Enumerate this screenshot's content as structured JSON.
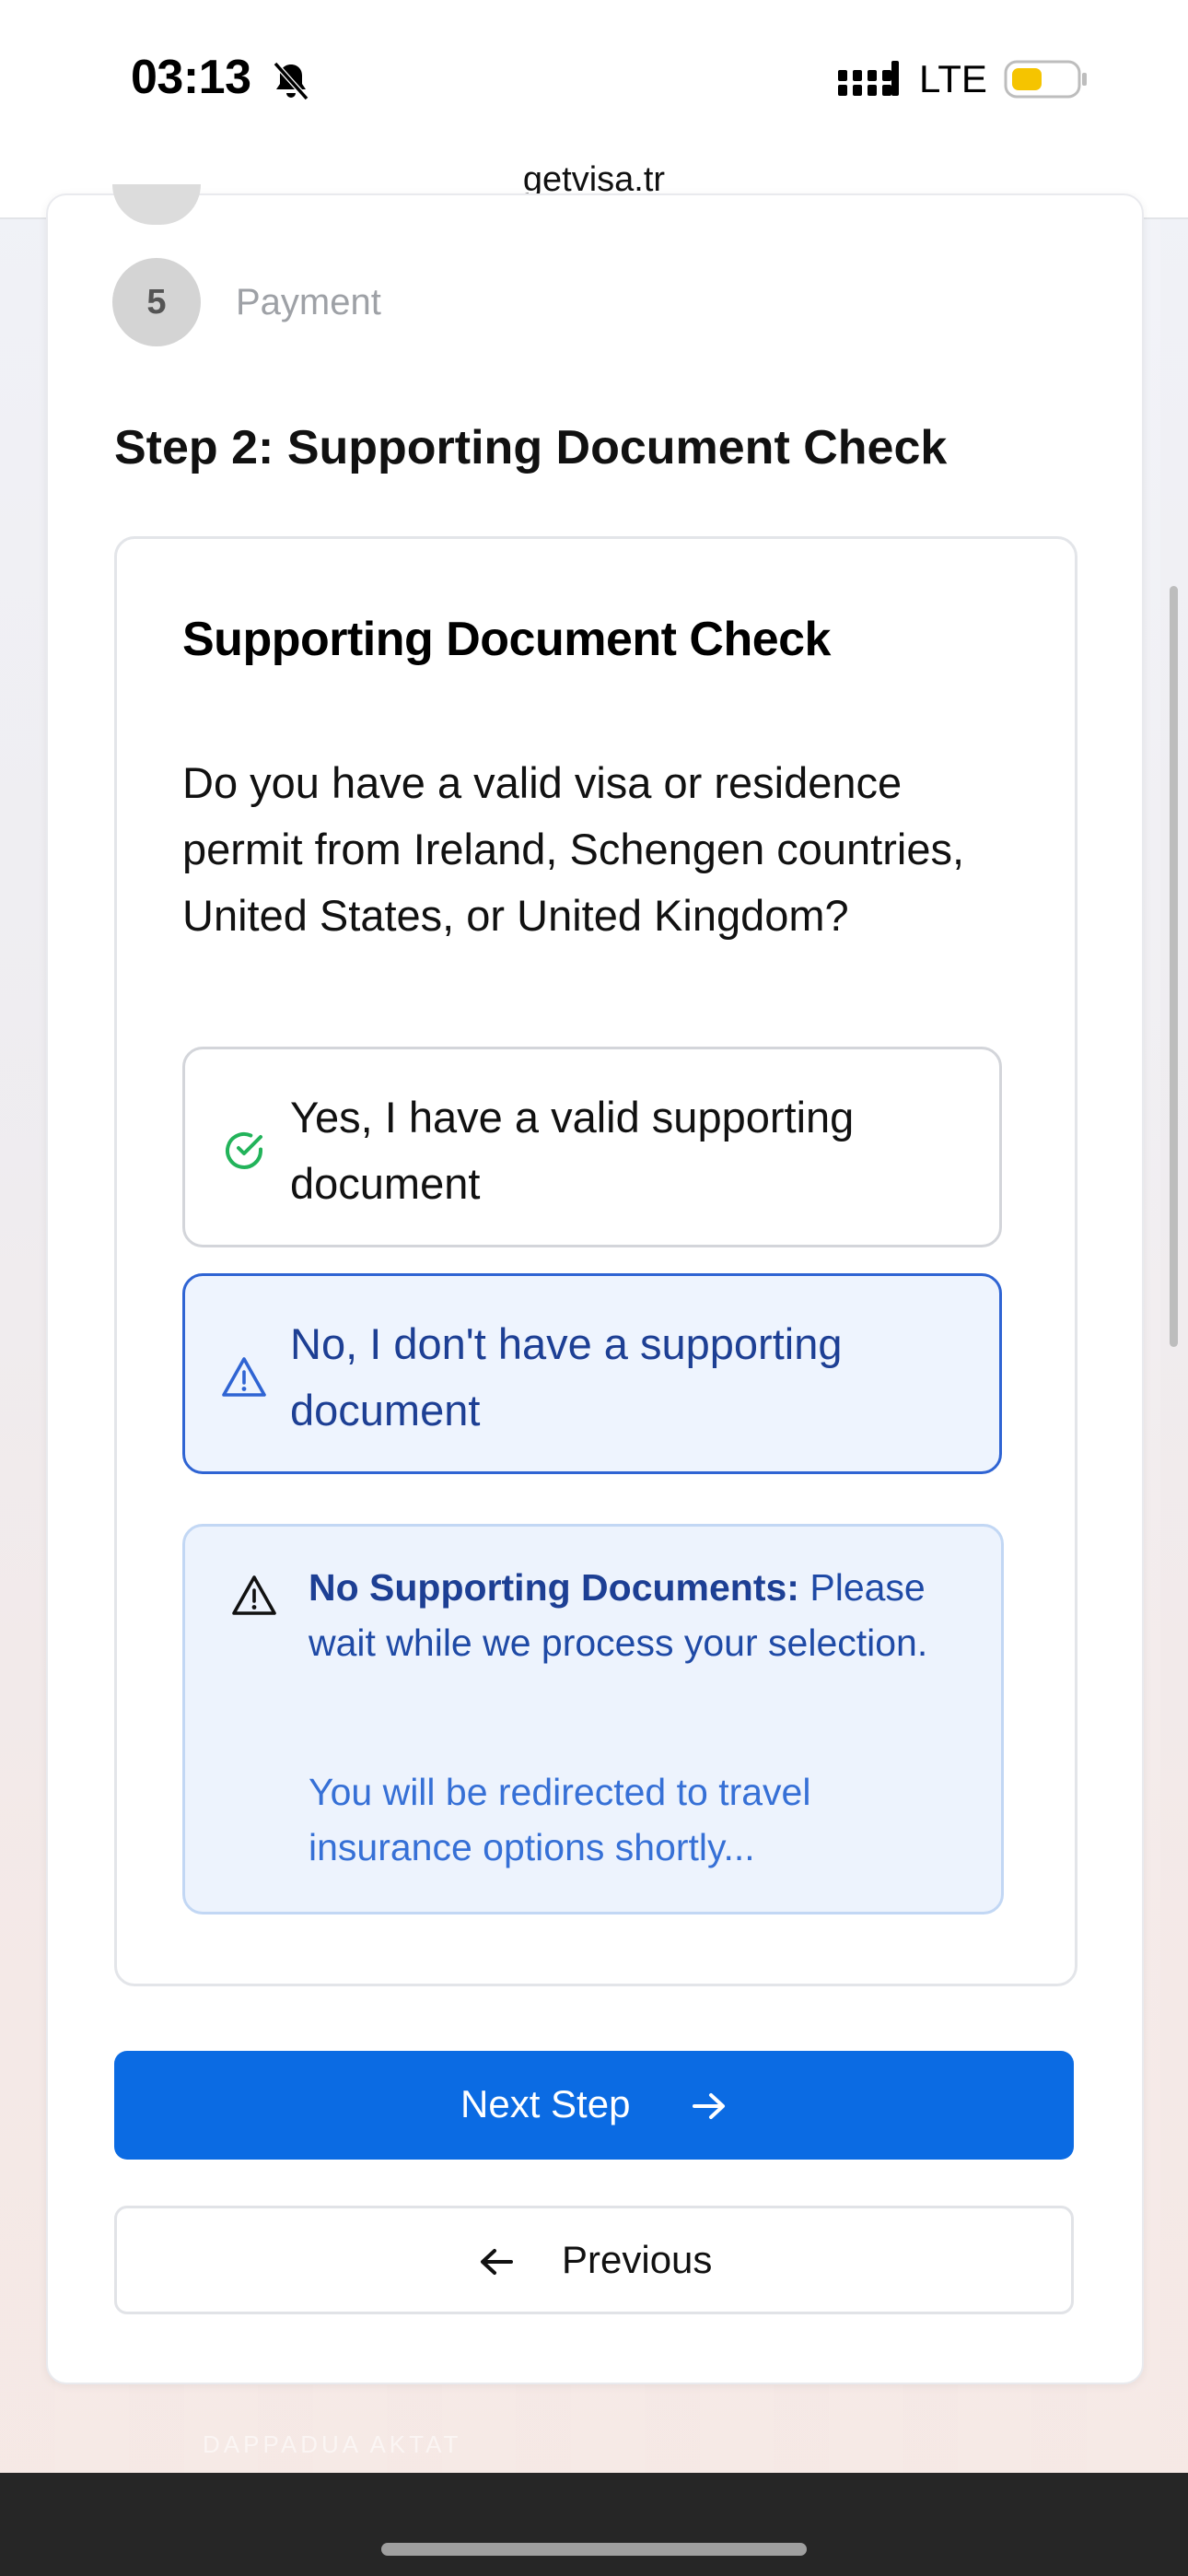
{
  "status_bar": {
    "time": "03:13",
    "network": "LTE",
    "battery_color": "#f5c400",
    "icons": [
      "bell-off-icon",
      "signal-icon",
      "battery-icon"
    ]
  },
  "browser": {
    "url": "getvisa.tr"
  },
  "steps": {
    "current_visible": {
      "number": "5",
      "label": "Payment"
    }
  },
  "section": {
    "heading": "Step 2: Supporting Document Check"
  },
  "card": {
    "title": "Supporting Document Check",
    "question": "Do you have a valid visa or residence permit from Ireland, Schengen countries, United States, or United Kingdom?",
    "options": [
      {
        "label": "Yes, I have a valid supporting document",
        "icon": "check-circle-icon",
        "selected": false
      },
      {
        "label": "No, I don't have a supporting document",
        "icon": "warning-icon",
        "selected": true
      }
    ],
    "alert": {
      "title": "No Supporting Documents:",
      "message": "Please wait while we process your selection.",
      "sub_message": "You will be redirected to travel insurance options shortly..."
    }
  },
  "buttons": {
    "next": "Next Step",
    "previous": "Previous"
  },
  "background": {
    "faded_text": "DAPPADUA AKTAT"
  },
  "colors": {
    "primary": "#0b6be3",
    "selected_border": "#2f64d3",
    "selected_bg": "#eef4fe",
    "success": "#22b35a",
    "alert_text": "#1d3f94"
  }
}
